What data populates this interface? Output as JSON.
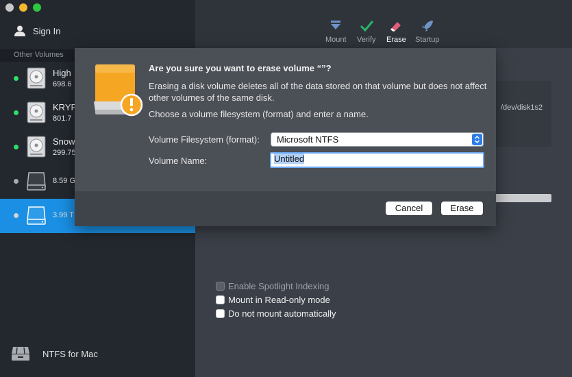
{
  "sidebar": {
    "sign_in": "Sign In",
    "section_label": "Other Volumes",
    "volumes": [
      {
        "name": "High",
        "size": "698.6",
        "status_color": "#2ee06a",
        "mounted": true
      },
      {
        "name": "KRYP",
        "size": "801.7",
        "status_color": "#2ee06a",
        "mounted": true
      },
      {
        "name": "Snow",
        "size": "299.75",
        "status_color": "#2ee06a",
        "mounted": true
      },
      {
        "name": "",
        "size": "8.59 G",
        "status_color": "#a8acb2",
        "mounted": false
      },
      {
        "name": "",
        "size": "3.99 T",
        "status_color": "#d0d4d9",
        "mounted": false,
        "selected": true
      }
    ],
    "brand": "NTFS for Mac"
  },
  "toolbar": {
    "mount": "Mount",
    "verify": "Verify",
    "erase": "Erase",
    "startup": "Startup"
  },
  "main": {
    "device": "/dev/disk1s2",
    "options": [
      {
        "label": "Enable Spotlight Indexing",
        "disabled": true
      },
      {
        "label": "Mount in Read-only mode",
        "disabled": false
      },
      {
        "label": "Do not mount automatically",
        "disabled": false
      }
    ]
  },
  "dialog": {
    "title": "Are you sure you want to erase volume “”?",
    "message": "Erasing a disk volume deletes all of the data stored on that volume but does not affect other volumes of the same disk.",
    "instruction": "Choose a volume filesystem (format) and enter a name.",
    "filesystem_label": "Volume Filesystem (format):",
    "filesystem_value": "Microsoft NTFS",
    "name_label": "Volume Name:",
    "name_value": "Untitled",
    "cancel": "Cancel",
    "erase": "Erase"
  },
  "colors": {
    "accent": "#1a8fe3",
    "sidebar_bg": "#23282f",
    "drive_orange": "#f5a623",
    "verify_green": "#29b36b",
    "erase_pink": "#e25d7a"
  },
  "icons": [
    "user-icon",
    "disk-icon",
    "mount-icon",
    "verify-icon",
    "erase-icon",
    "startup-icon",
    "warning-icon",
    "brand-icon"
  ]
}
